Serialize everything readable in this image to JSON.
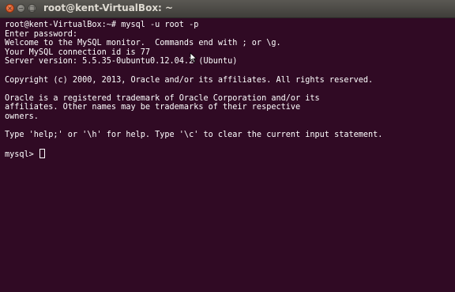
{
  "window": {
    "title": "root@kent-VirtualBox: ~",
    "close_glyph": "×",
    "minimize_glyph": "−",
    "maximize_glyph": "□"
  },
  "terminal": {
    "lines": [
      "root@kent-VirtualBox:~# mysql -u root -p",
      "Enter password:",
      "Welcome to the MySQL monitor.  Commands end with ; or \\g.",
      "Your MySQL connection id is 77",
      "Server version: 5.5.35-0ubuntu0.12.04.2 (Ubuntu)",
      "",
      "Copyright (c) 2000, 2013, Oracle and/or its affiliates. All rights reserved.",
      "",
      "Oracle is a registered trademark of Oracle Corporation and/or its",
      "affiliates. Other names may be trademarks of their respective",
      "owners.",
      "",
      "Type 'help;' or '\\h' for help. Type '\\c' to clear the current input statement.",
      ""
    ],
    "prompt": "mysql> "
  },
  "colors": {
    "background": "#300a24",
    "text": "#ffffff",
    "titlebar": "#3f3e3a",
    "close_button": "#d24514"
  },
  "icons": {
    "close": "close-icon",
    "minimize": "minimize-icon",
    "maximize": "maximize-icon",
    "cursor": "text-cursor-icon",
    "pointer": "mouse-pointer-icon"
  }
}
